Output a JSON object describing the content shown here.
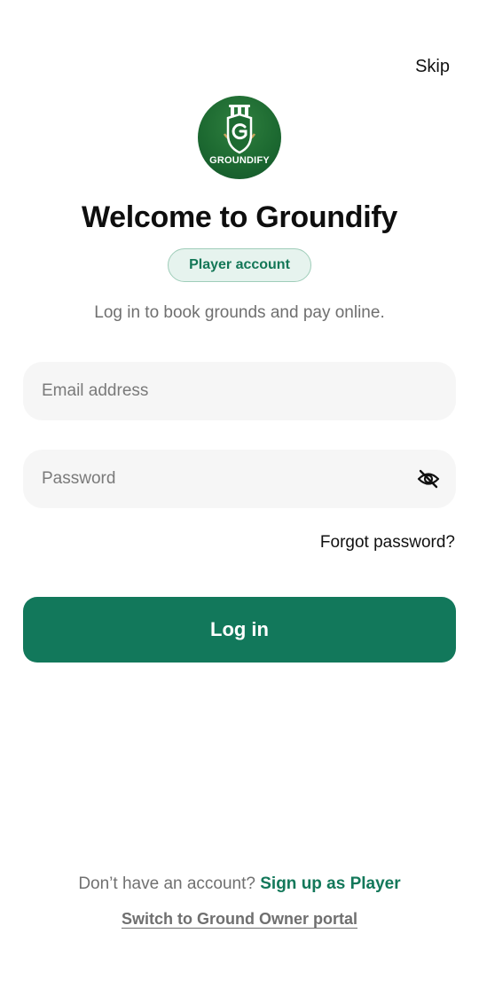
{
  "header": {
    "skip_label": "Skip"
  },
  "logo": {
    "text": "GROUNDIFY",
    "icon": "cricket-stumps-shield-g-icon",
    "colors": {
      "outer": "#1d6a31",
      "inner": "#12552a",
      "gold": "#c9a45c"
    }
  },
  "welcome": {
    "title": "Welcome to Groundify",
    "badge": "Player account",
    "subtitle": "Log in to book grounds and pay online."
  },
  "form": {
    "email": {
      "placeholder": "Email address",
      "value": ""
    },
    "password": {
      "placeholder": "Password",
      "value": "",
      "toggle_icon": "eye-off-icon"
    },
    "forgot_label": "Forgot password?",
    "login_label": "Log in"
  },
  "footer": {
    "no_account_text": "Don’t have an account?",
    "signup_label": "Sign up as Player",
    "switch_label": "Switch to Ground Owner portal"
  },
  "colors": {
    "primary": "#12785b",
    "badge_bg": "#e6f3ee",
    "badge_border": "#9fcdb9",
    "field_bg": "#f6f6f6",
    "muted_text": "#6f6f6f"
  }
}
